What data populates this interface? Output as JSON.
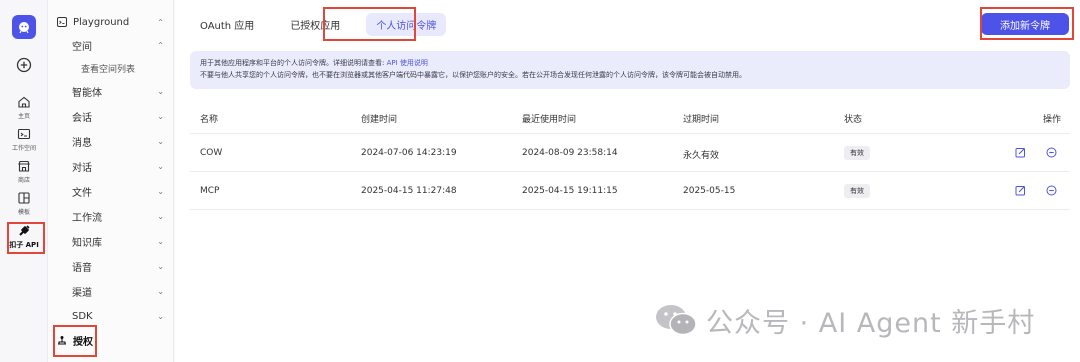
{
  "rail": {
    "items": [
      {
        "label": "主页"
      },
      {
        "label": "工作空间"
      },
      {
        "label": "商店"
      },
      {
        "label": "模板"
      },
      {
        "label": "扣子 API"
      }
    ]
  },
  "nav": {
    "title": "Playground",
    "items": [
      {
        "label": "空间"
      },
      {
        "label": "查看空间列表"
      },
      {
        "label": "智能体"
      },
      {
        "label": "会话"
      },
      {
        "label": "消息"
      },
      {
        "label": "对话"
      },
      {
        "label": "文件"
      },
      {
        "label": "工作流"
      },
      {
        "label": "知识库"
      },
      {
        "label": "语音"
      },
      {
        "label": "渠道"
      },
      {
        "label": "SDK"
      }
    ],
    "auth_label": "授权"
  },
  "tabs": [
    "OAuth 应用",
    "已授权应用",
    "个人访问令牌"
  ],
  "add_button": "添加新令牌",
  "notice": {
    "line1": "用于其他应用程序和平台的个人访问令牌。详细说明请查看: ",
    "link": "API 使用说明",
    "line2": "不要与他人共享您的个人访问令牌，也不要在浏览器或其他客户端代码中暴露它，以保护您账户的安全。若在公开场合发现任何泄露的个人访问令牌，该令牌可能会被自动禁用。"
  },
  "table": {
    "headers": [
      "名称",
      "创建时间",
      "最近使用时间",
      "过期时间",
      "状态",
      "操作"
    ],
    "rows": [
      {
        "name": "COW",
        "created": "2024-07-06 14:23:19",
        "last_used": "2024-08-09 23:58:14",
        "expires": "永久有效",
        "status": "有效"
      },
      {
        "name": "MCP",
        "created": "2025-04-15 11:27:48",
        "last_used": "2025-04-15 19:11:15",
        "expires": "2025-05-15",
        "status": "有效"
      }
    ]
  },
  "watermark": "公众号 · AI Agent 新手村",
  "colors": {
    "accent": "#4d53e8",
    "highlight": "#e0463a"
  }
}
